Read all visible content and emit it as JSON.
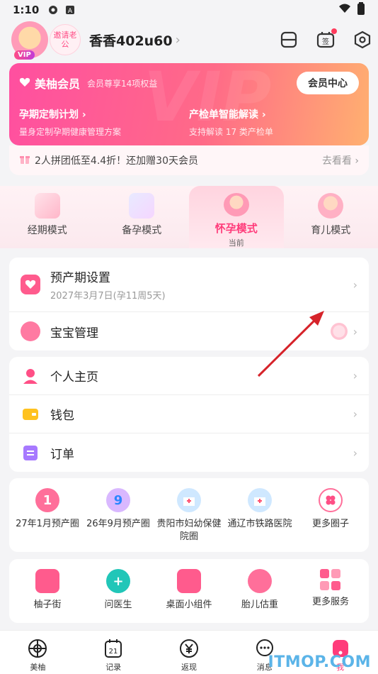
{
  "status_bar": {
    "time": "1:10"
  },
  "profile": {
    "username": "香香402u60",
    "vip_badge": "VIP",
    "invite_label": "邀请老公"
  },
  "vip_card": {
    "title": "美柚会员",
    "subtitle": "会员尊享14项权益",
    "center_button": "会员中心",
    "features": [
      {
        "title": "孕期定制计划",
        "desc": "量身定制孕期健康管理方案"
      },
      {
        "title": "产检单智能解读",
        "desc": "支持解读 17 类产检单"
      }
    ]
  },
  "promo": {
    "text": "2人拼团低至4.4折！还加赠30天会员",
    "action": "去看看"
  },
  "modes": {
    "items": [
      {
        "label": "经期模式"
      },
      {
        "label": "备孕模式"
      },
      {
        "label": "怀孕模式"
      },
      {
        "label": "育儿模式"
      }
    ],
    "current_label": "当前"
  },
  "pregnancy_card": {
    "due_title": "预产期设置",
    "due_sub": "2027年3月7日(孕11周5天)",
    "baby_title": "宝宝管理"
  },
  "account_card": {
    "items": [
      {
        "label": "个人主页"
      },
      {
        "label": "钱包"
      },
      {
        "label": "订单"
      }
    ]
  },
  "circles": {
    "items": [
      {
        "label": "27年1月预产圈",
        "icon": "number-1-icon"
      },
      {
        "label": "26年9月预产圈",
        "icon": "number-9-icon"
      },
      {
        "label": "贵阳市妇幼保健院圈",
        "icon": "hospital-icon"
      },
      {
        "label": "通辽市铁路医院",
        "icon": "hospital-icon"
      },
      {
        "label": "更多圈子",
        "icon": "clover-icon"
      }
    ]
  },
  "services": {
    "items": [
      {
        "label": "柚子街",
        "icon": "bag-icon"
      },
      {
        "label": "问医生",
        "icon": "chat-plus-icon"
      },
      {
        "label": "桌面小组件",
        "icon": "widget-icon"
      },
      {
        "label": "胎儿估重",
        "icon": "baby-face-icon"
      },
      {
        "label": "更多服务",
        "icon": "grid-icon"
      }
    ]
  },
  "tabbar": {
    "items": [
      {
        "label": "美柚"
      },
      {
        "label": "记录"
      },
      {
        "label": "返现"
      },
      {
        "label": "消息"
      },
      {
        "label": "我"
      }
    ],
    "record_day": "21"
  },
  "watermark": "ITMOP.COM",
  "colors": {
    "accent": "#ff3b7a",
    "vip_gradient_start": "#ff4fa0",
    "vip_gradient_end": "#ffb070"
  }
}
